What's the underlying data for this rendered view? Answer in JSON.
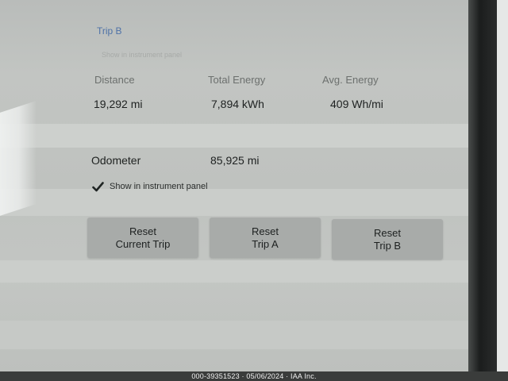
{
  "trip": {
    "title": "Trip B",
    "hint": "Show in instrument panel"
  },
  "stats": [
    {
      "label": "Distance",
      "value": "19,292 mi"
    },
    {
      "label": "Total Energy",
      "value": "7,894 kWh"
    },
    {
      "label": "Avg. Energy",
      "value": "409 Wh/mi"
    }
  ],
  "odometer": {
    "label": "Odometer",
    "value": "85,925 mi"
  },
  "instrument_panel": {
    "label": "Show in instrument panel",
    "checked": true
  },
  "buttons": {
    "reset_current": {
      "line1": "Reset",
      "line2": "Current Trip"
    },
    "reset_a": {
      "line1": "Reset",
      "line2": "Trip A"
    },
    "reset_b": {
      "line1": "Reset",
      "line2": "Trip B"
    }
  },
  "footer": {
    "watermark": "000-39351523 · 05/06/2024 · IAA Inc."
  },
  "colors": {
    "accent": "#4f72a8",
    "button": "#a8aba9",
    "screen": "#c0c3c0"
  }
}
